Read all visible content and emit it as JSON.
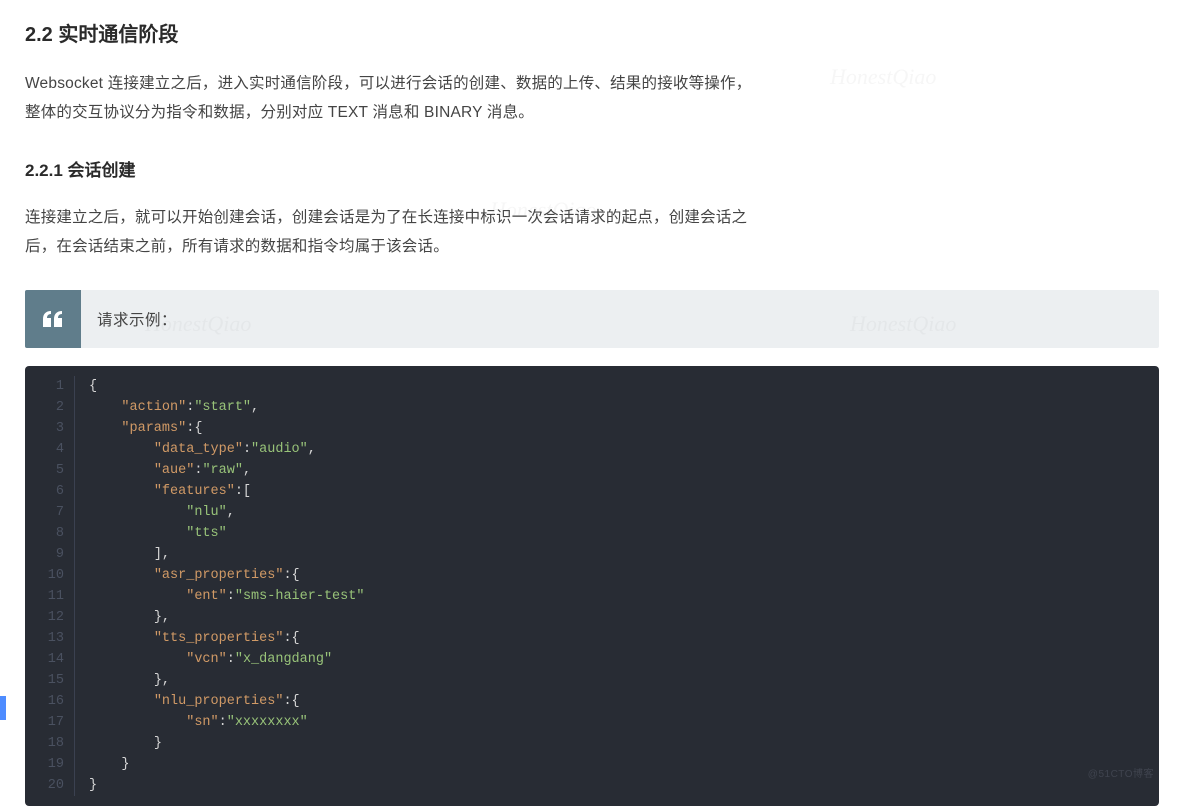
{
  "headings": {
    "h2": "2.2 实时通信阶段",
    "h3": "2.2.1 会话创建"
  },
  "paragraphs": {
    "p1": "Websocket 连接建立之后，进入实时通信阶段，可以进行会话的创建、数据的上传、结果的接收等操作，整体的交互协议分为指令和数据，分别对应 TEXT 消息和 BINARY 消息。",
    "p2": "连接建立之后，就可以开始创建会话，创建会话是为了在长连接中标识一次会话请求的起点，创建会话之后，在会话结束之前，所有请求的数据和指令均属于该会话。"
  },
  "blockquote": {
    "label": "请求示例："
  },
  "code": {
    "lines": [
      [
        {
          "t": "punc",
          "v": "{"
        }
      ],
      [
        {
          "t": "pad",
          "v": "    "
        },
        {
          "t": "key",
          "v": "\"action\""
        },
        {
          "t": "punc",
          "v": ":"
        },
        {
          "t": "str",
          "v": "\"start\""
        },
        {
          "t": "punc",
          "v": ","
        }
      ],
      [
        {
          "t": "pad",
          "v": "    "
        },
        {
          "t": "key",
          "v": "\"params\""
        },
        {
          "t": "punc",
          "v": ":{"
        }
      ],
      [
        {
          "t": "pad",
          "v": "        "
        },
        {
          "t": "key",
          "v": "\"data_type\""
        },
        {
          "t": "punc",
          "v": ":"
        },
        {
          "t": "str",
          "v": "\"audio\""
        },
        {
          "t": "punc",
          "v": ","
        }
      ],
      [
        {
          "t": "pad",
          "v": "        "
        },
        {
          "t": "key",
          "v": "\"aue\""
        },
        {
          "t": "punc",
          "v": ":"
        },
        {
          "t": "str",
          "v": "\"raw\""
        },
        {
          "t": "punc",
          "v": ","
        }
      ],
      [
        {
          "t": "pad",
          "v": "        "
        },
        {
          "t": "key",
          "v": "\"features\""
        },
        {
          "t": "punc",
          "v": ":["
        }
      ],
      [
        {
          "t": "pad",
          "v": "            "
        },
        {
          "t": "str",
          "v": "\"nlu\""
        },
        {
          "t": "punc",
          "v": ","
        }
      ],
      [
        {
          "t": "pad",
          "v": "            "
        },
        {
          "t": "str",
          "v": "\"tts\""
        }
      ],
      [
        {
          "t": "pad",
          "v": "        "
        },
        {
          "t": "punc",
          "v": "],"
        }
      ],
      [
        {
          "t": "pad",
          "v": "        "
        },
        {
          "t": "key",
          "v": "\"asr_properties\""
        },
        {
          "t": "punc",
          "v": ":{"
        }
      ],
      [
        {
          "t": "pad",
          "v": "            "
        },
        {
          "t": "key",
          "v": "\"ent\""
        },
        {
          "t": "punc",
          "v": ":"
        },
        {
          "t": "str",
          "v": "\"sms-haier-test\""
        }
      ],
      [
        {
          "t": "pad",
          "v": "        "
        },
        {
          "t": "punc",
          "v": "},"
        }
      ],
      [
        {
          "t": "pad",
          "v": "        "
        },
        {
          "t": "key",
          "v": "\"tts_properties\""
        },
        {
          "t": "punc",
          "v": ":{"
        }
      ],
      [
        {
          "t": "pad",
          "v": "            "
        },
        {
          "t": "key",
          "v": "\"vcn\""
        },
        {
          "t": "punc",
          "v": ":"
        },
        {
          "t": "str",
          "v": "\"x_dangdang\""
        }
      ],
      [
        {
          "t": "pad",
          "v": "        "
        },
        {
          "t": "punc",
          "v": "},"
        }
      ],
      [
        {
          "t": "pad",
          "v": "        "
        },
        {
          "t": "key",
          "v": "\"nlu_properties\""
        },
        {
          "t": "punc",
          "v": ":{"
        }
      ],
      [
        {
          "t": "pad",
          "v": "            "
        },
        {
          "t": "key",
          "v": "\"sn\""
        },
        {
          "t": "punc",
          "v": ":"
        },
        {
          "t": "str",
          "v": "\"xxxxxxxx\""
        }
      ],
      [
        {
          "t": "pad",
          "v": "        "
        },
        {
          "t": "punc",
          "v": "}"
        }
      ],
      [
        {
          "t": "pad",
          "v": "    "
        },
        {
          "t": "punc",
          "v": "}"
        }
      ],
      [
        {
          "t": "punc",
          "v": "}"
        }
      ]
    ]
  },
  "watermarks": {
    "text": "HonestQiao",
    "footer": "@51CTO博客"
  }
}
